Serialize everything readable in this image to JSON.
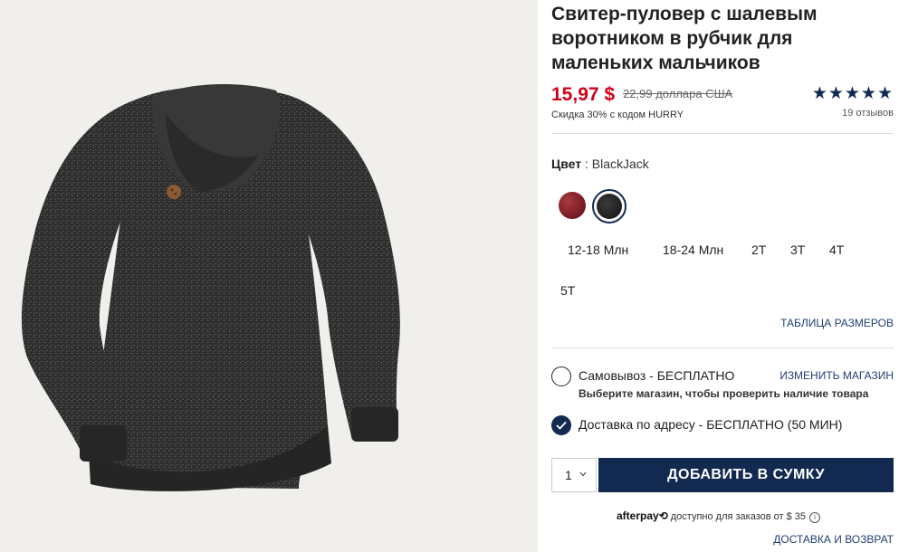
{
  "product": {
    "title": "Свитер-пуловер с шалевым воротником в рубчик для маленьких мальчиков",
    "price_sale": "15,97 $",
    "price_old": "22,99 доллара США",
    "discount_note": "Скидка 30% с кодом HURRY",
    "rating_stars": "★★★★★",
    "rating": 5,
    "reviews": "19 отзывов"
  },
  "color": {
    "label": "Цвет",
    "separator": " : ",
    "selected": "BlackJack",
    "swatches": [
      {
        "name": "red",
        "color": "#7a1d24"
      },
      {
        "name": "BlackJack",
        "color": "#222222",
        "selected": true
      }
    ]
  },
  "sizes": [
    "12-18 Млн",
    "18-24 Млн",
    "2T",
    "3T",
    "4T",
    "5T"
  ],
  "size_chart": "ТАБЛИЦА РАЗМЕРОВ",
  "fulfillment": {
    "pickup_label": "Самовывоз - БЕСПЛАТНО",
    "change_store": "ИЗМЕНИТЬ МАГАЗИН",
    "pickup_sub": "Выберите магазин, чтобы проверить наличие товара",
    "ship_label": "Доставка по адресу - БЕСПЛАТНО (50 МИН)"
  },
  "cart": {
    "quantity": "1",
    "add_label": "ДОБАВИТЬ В СУМКУ"
  },
  "afterpay": {
    "logo": "afterpay⟲",
    "text": "доступно для заказов от $ 35",
    "info": "i"
  },
  "return_link": "ДОСТАВКА И ВОЗВРАТ",
  "colors": {
    "accent": "#122a4f",
    "sale": "#d0011b",
    "link": "#1f3f73"
  }
}
